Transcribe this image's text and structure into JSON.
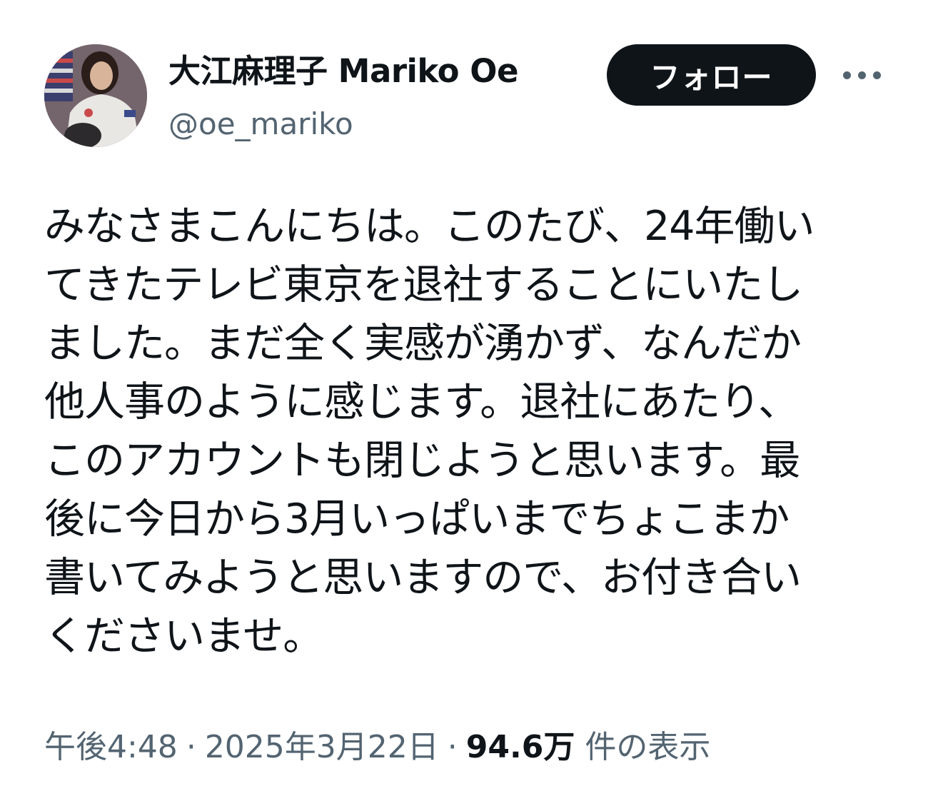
{
  "author": {
    "display_name": "大江麻理子 Mariko Oe",
    "handle": "@oe_mariko"
  },
  "actions": {
    "follow_label": "フォロー",
    "more_icon": "more-horizontal-icon"
  },
  "tweet": {
    "lines": [
      "みなさまこんにちは。このたび、24年働い",
      "てきたテレビ東京を退社することにいたし",
      "ました。まだ全く実感が湧かず、なんだか",
      "他人事のように感じます。退社にあたり、",
      "このアカウントも閉じようと思います。最",
      "後に今日から3月いっぱいまでちょこまか",
      "書いてみようと思いますので、お付き合い",
      "くださいませ。"
    ]
  },
  "meta": {
    "time": "午後4:48",
    "separator": "·",
    "date": "2025年3月22日",
    "views_count": "94.6万",
    "views_label": "件の表示"
  },
  "colors": {
    "text": "#0f1419",
    "secondary": "#536471",
    "follow_bg": "#0f1419",
    "follow_text": "#ffffff"
  }
}
